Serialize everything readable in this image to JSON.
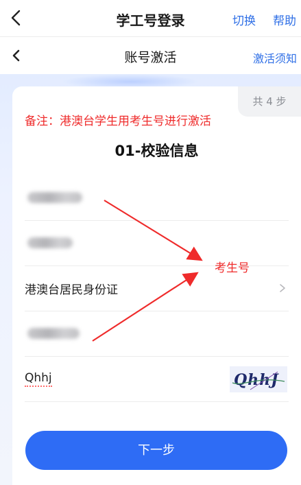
{
  "topbar": {
    "title": "学工号登录",
    "switch_label": "切换",
    "help_label": "帮助"
  },
  "subbar": {
    "title": "账号激活",
    "notice_label": "激活须知"
  },
  "card": {
    "step_badge": "共 4 步",
    "remark": "备注：港澳台学生用考生号进行激活",
    "section_title": "01-校验信息",
    "id_type_label": "港澳台居民身份证",
    "captcha_value": "Qhhj",
    "captcha_image_text": "QhhJ"
  },
  "annotation": {
    "label": "考生号"
  },
  "actions": {
    "next_label": "下一步"
  },
  "colors": {
    "primary": "#2e6cf5",
    "link": "#2f6fe6",
    "annotation_red": "#ef2b2b"
  },
  "icons": {
    "back": "chevron-left-icon",
    "chevron": "chevron-right-icon"
  }
}
